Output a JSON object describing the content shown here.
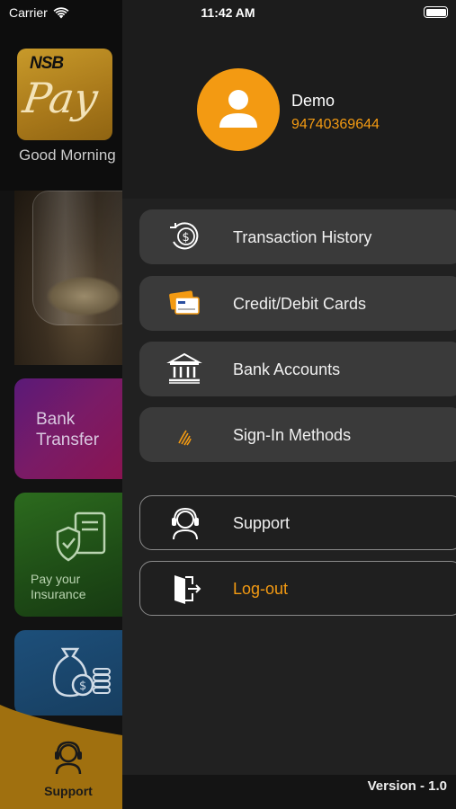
{
  "status_bar": {
    "carrier": "Carrier",
    "time": "11:42 AM"
  },
  "background_app": {
    "logo": {
      "top_text": "NSB",
      "main_text": "Pay"
    },
    "greeting": "Good Morning",
    "tiles": {
      "bank_transfer": "Bank Transfer",
      "insurance": "Pay your Insurance"
    },
    "bottom_tab": {
      "label": "Support"
    },
    "colors": {
      "tab_background": "#a0700f",
      "bank_tile": "#6a1a6f",
      "insurance_tile": "#245a1a",
      "pay_tile": "#1b466d"
    }
  },
  "drawer": {
    "user": {
      "name": "Demo",
      "phone": "94740369644"
    },
    "menu": [
      {
        "label": "Transaction History",
        "icon": "dollar-history-icon"
      },
      {
        "label": "Credit/Debit Cards",
        "icon": "credit-card-icon"
      },
      {
        "label": "Bank Accounts",
        "icon": "bank-building-icon"
      },
      {
        "label": "Sign-In Methods",
        "icon": "fingerprint-icon"
      }
    ],
    "support": {
      "label": "Support",
      "icon": "headset-icon"
    },
    "logout": {
      "label": "Log-out",
      "icon": "door-exit-icon"
    },
    "version": "Version - 1.0",
    "colors": {
      "accent": "#f39a12",
      "menu_item_bg": "#3a3a3a",
      "drawer_bg": "#212121"
    }
  }
}
